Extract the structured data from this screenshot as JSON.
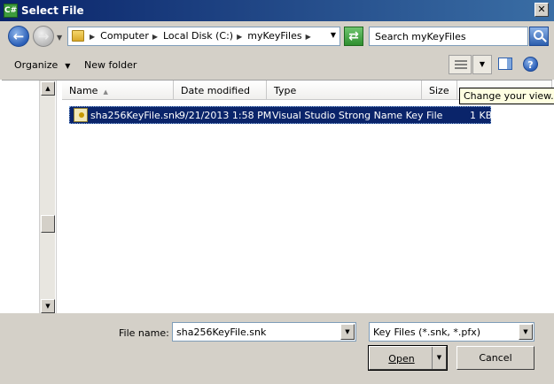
{
  "window": {
    "title": "Select File",
    "app_icon": "C#"
  },
  "address": {
    "crumbs": [
      "Computer",
      "Local Disk (C:)",
      "myKeyFiles"
    ],
    "search_placeholder": "Search myKeyFiles"
  },
  "toolbar": {
    "organize_label": "Organize",
    "new_folder_label": "New folder",
    "tooltip": "Change your view."
  },
  "columns": [
    "Name",
    "Date modified",
    "Type",
    "Size"
  ],
  "files": [
    {
      "name": "sha256KeyFile.snk",
      "date": "9/21/2013 1:58 PM",
      "type": "Visual Studio Strong Name Key File",
      "size": "1 KB"
    }
  ],
  "bottom": {
    "file_name_label": "File name:",
    "file_name_value": "sha256KeyFile.snk",
    "file_type_value": "Key Files (*.snk, *.pfx)",
    "open_label": "Open",
    "cancel_label": "Cancel"
  },
  "icons": {
    "back": "arrow-left-icon",
    "forward": "arrow-right-icon",
    "folder": "folder-icon",
    "refresh": "refresh-icon",
    "search": "search-icon",
    "views": "views-icon",
    "preview": "preview-pane-icon",
    "help": "help-icon",
    "file": "key-file-icon"
  },
  "colors": {
    "selection": "#0a246a",
    "titlebar": "#0a246a",
    "chrome": "#d4d0c8"
  }
}
